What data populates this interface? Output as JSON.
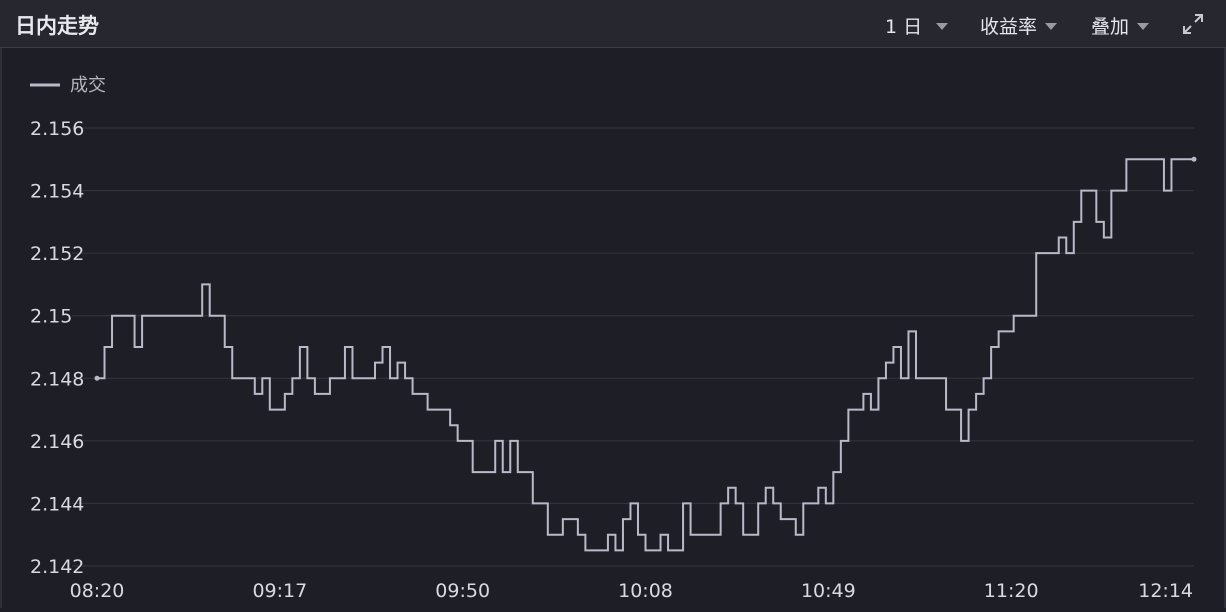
{
  "header": {
    "title": "日内走势",
    "period_label": "1 日",
    "metric_label": "收益率",
    "overlay_label": "叠加"
  },
  "icons": {
    "period_caret": "caret-down-icon",
    "metric_caret": "caret-down-icon",
    "overlay_caret": "caret-down-icon",
    "expand": "expand-icon"
  },
  "colors": {
    "background": "#1e1f26",
    "header_bg": "#26272f",
    "line": "#b9b9c9",
    "grid": "#34353f",
    "text": "#d9d9e0"
  },
  "chart_data": {
    "type": "line",
    "legend": [
      "成交"
    ],
    "legend_position": "top-left",
    "grid": true,
    "ylim": [
      2.142,
      2.156
    ],
    "yticks": [
      "2.142",
      "2.144",
      "2.146",
      "2.148",
      "2.15",
      "2.152",
      "2.154",
      "2.156"
    ],
    "xticks": [
      "08:20",
      "09:17",
      "09:50",
      "10:08",
      "10:49",
      "11:20",
      "12:14"
    ],
    "series": [
      {
        "name": "成交",
        "values": [
          2.148,
          2.149,
          2.15,
          2.15,
          2.15,
          2.149,
          2.15,
          2.15,
          2.15,
          2.15,
          2.15,
          2.15,
          2.15,
          2.15,
          2.151,
          2.15,
          2.15,
          2.149,
          2.148,
          2.148,
          2.148,
          2.1475,
          2.148,
          2.147,
          2.147,
          2.1475,
          2.148,
          2.149,
          2.148,
          2.1475,
          2.1475,
          2.148,
          2.148,
          2.149,
          2.148,
          2.148,
          2.148,
          2.1485,
          2.149,
          2.148,
          2.1485,
          2.148,
          2.1475,
          2.1475,
          2.147,
          2.147,
          2.147,
          2.1465,
          2.146,
          2.146,
          2.145,
          2.145,
          2.145,
          2.146,
          2.145,
          2.146,
          2.145,
          2.145,
          2.144,
          2.144,
          2.143,
          2.143,
          2.1435,
          2.1435,
          2.143,
          2.1425,
          2.1425,
          2.1425,
          2.143,
          2.1425,
          2.1435,
          2.144,
          2.143,
          2.1425,
          2.1425,
          2.143,
          2.1425,
          2.1425,
          2.144,
          2.143,
          2.143,
          2.143,
          2.143,
          2.144,
          2.1445,
          2.144,
          2.143,
          2.143,
          2.144,
          2.1445,
          2.144,
          2.1435,
          2.1435,
          2.143,
          2.144,
          2.144,
          2.1445,
          2.144,
          2.145,
          2.146,
          2.147,
          2.147,
          2.1475,
          2.147,
          2.148,
          2.1485,
          2.149,
          2.148,
          2.1495,
          2.148,
          2.148,
          2.148,
          2.148,
          2.147,
          2.147,
          2.146,
          2.147,
          2.1475,
          2.148,
          2.149,
          2.1495,
          2.1495,
          2.15,
          2.15,
          2.15,
          2.152,
          2.152,
          2.152,
          2.1525,
          2.152,
          2.153,
          2.154,
          2.154,
          2.153,
          2.1525,
          2.154,
          2.154,
          2.155,
          2.155,
          2.155,
          2.155,
          2.155,
          2.154,
          2.155,
          2.155,
          2.155,
          2.155
        ]
      }
    ]
  }
}
